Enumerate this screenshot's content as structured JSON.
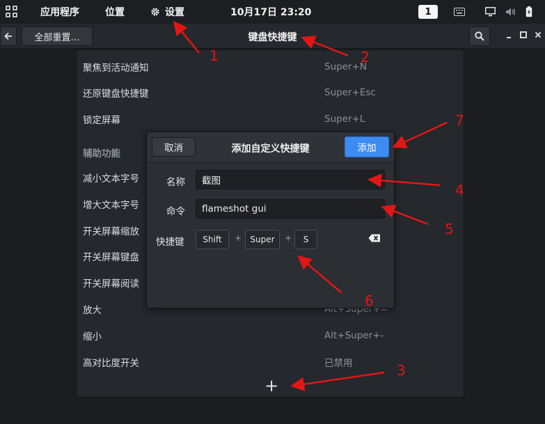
{
  "topbar": {
    "apps": "应用程序",
    "places": "位置",
    "settings": "设置",
    "clock": "10月17日 23:20",
    "workspace": "1"
  },
  "header": {
    "reset_label": "全部重置…",
    "title": "键盘快捷键"
  },
  "shortcuts_above": [
    {
      "name": "聚焦到活动通知",
      "accel": "Super+N"
    },
    {
      "name": "还原键盘快捷键",
      "accel": "Super+Esc"
    },
    {
      "name": "锁定屏幕",
      "accel": "Super+L"
    }
  ],
  "accessibility": {
    "section": "辅助功能",
    "items": [
      {
        "name": "减小文本字号",
        "accel": ""
      },
      {
        "name": "增大文本字号",
        "accel": ""
      },
      {
        "name": "开关屏幕缩放",
        "accel": ""
      },
      {
        "name": "开关屏幕键盘",
        "accel": ""
      },
      {
        "name": "开关屏幕阅读",
        "accel": ""
      },
      {
        "name": "放大",
        "accel": "Alt+Super+="
      },
      {
        "name": "缩小",
        "accel": "Alt+Super+-"
      },
      {
        "name": "高对比度开关",
        "accel": "已禁用"
      }
    ]
  },
  "add_button_symbol": "+",
  "dialog": {
    "cancel": "取消",
    "title": "添加自定义快捷键",
    "add": "添加",
    "name_label": "名称",
    "name_value": "截图",
    "command_label": "命令",
    "command_value": "flameshot gui",
    "shortcut_label": "快捷键",
    "keys": [
      "Shift",
      "Super",
      "S"
    ],
    "key_sep": "+"
  },
  "annotations": [
    "1",
    "2",
    "3",
    "4",
    "5",
    "6",
    "7"
  ],
  "colors": {
    "accent": "#3c8cf4",
    "annotation": "#e31616",
    "background": "#1b1d20",
    "panel": "#25282c"
  }
}
